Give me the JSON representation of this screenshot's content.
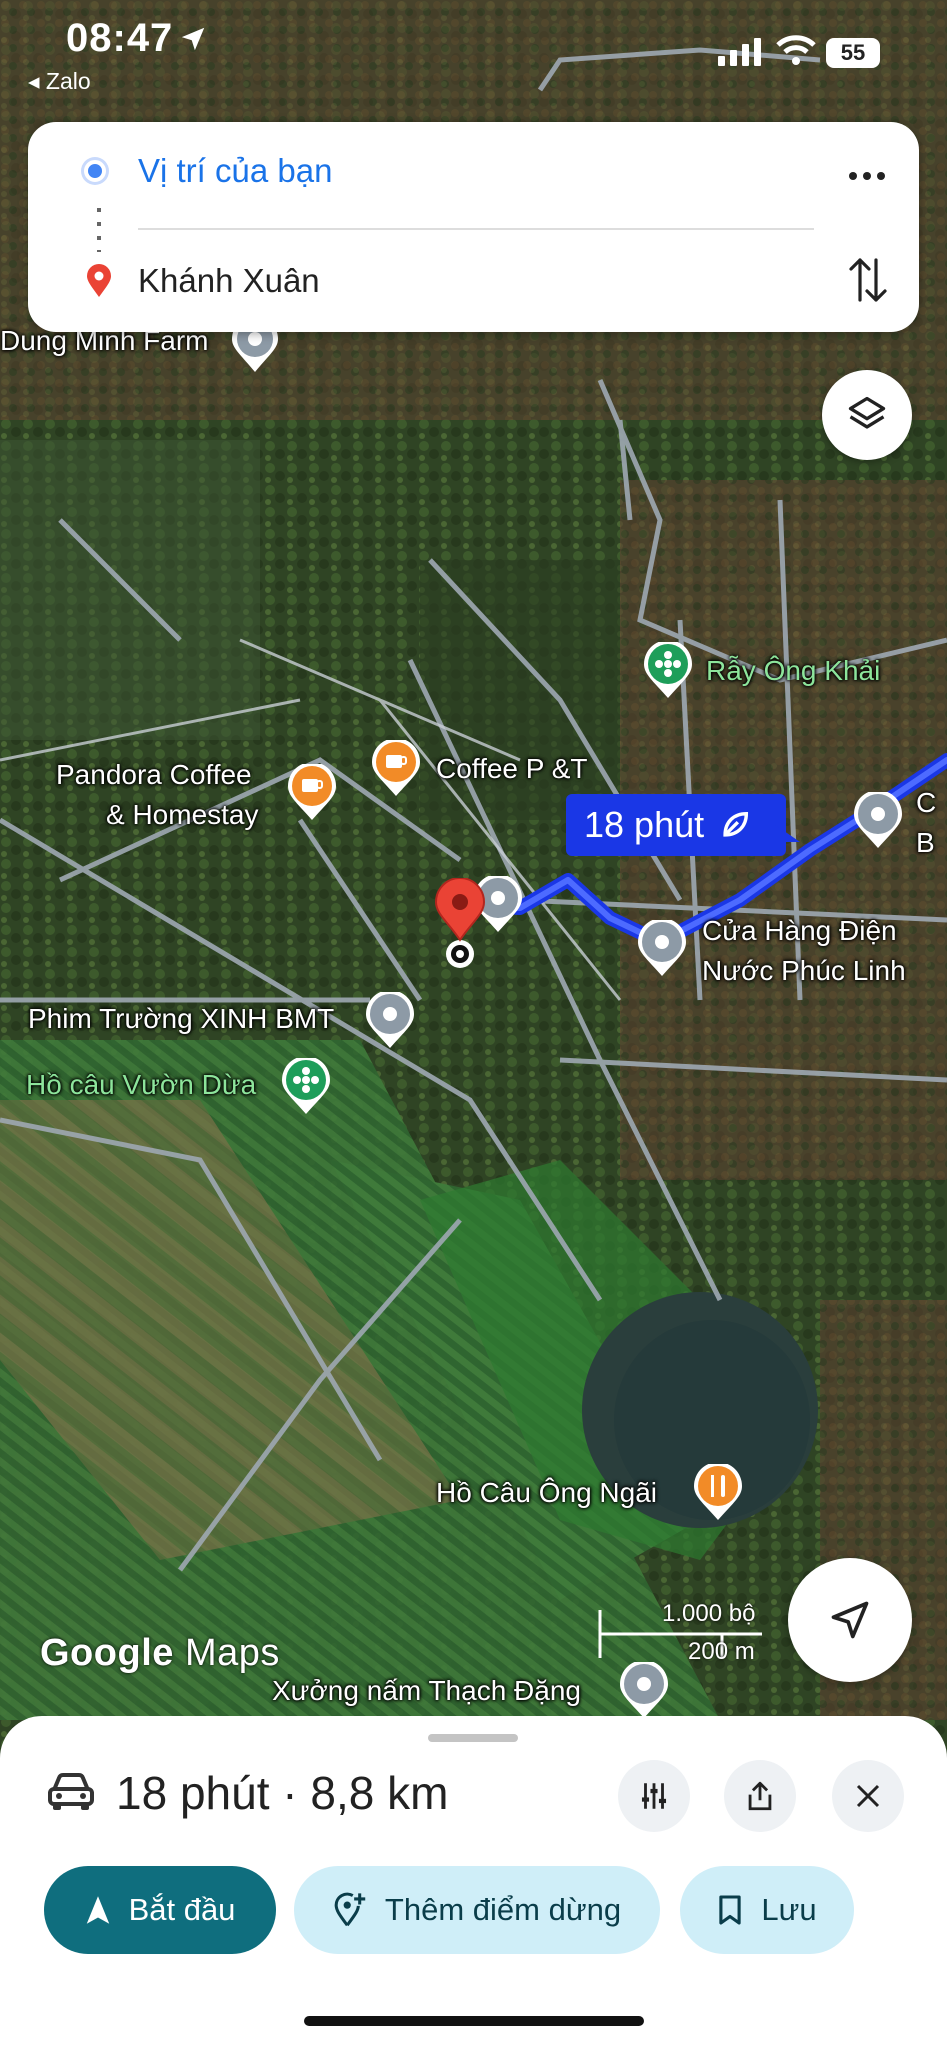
{
  "status_bar": {
    "time": "08:47",
    "back_app": "◂ Zalo",
    "battery": "55"
  },
  "directions": {
    "origin": "Vị trí của bạn",
    "destination": "Khánh Xuân"
  },
  "map": {
    "route_bubble": "18 phút",
    "pois": {
      "dung_minh_farm": "Dung Minh Farm",
      "ray_ong_khai": "Rẫy Ông Khải",
      "pandora_line1": "Pandora Coffee",
      "pandora_line2": "& Homestay",
      "coffee_pt": "Coffee P &T",
      "cua_hang_line1": "Cửa Hàng Điện",
      "cua_hang_line2": "Nước Phúc Linh",
      "phim_truong": "Phim Trường XINH BMT",
      "ho_cau_vuon_dua": "Hồ câu Vườn Dừa",
      "ho_cau_ong_ngai": "Hồ Câu Ông Ngãi",
      "xuong_nam": "Xưởng nấm Thạch Đặng",
      "partial_label_line1": "C",
      "partial_label_line2": "B"
    },
    "logo_google": "Google",
    "logo_maps": "Maps",
    "scale_feet": "1.000 bộ",
    "scale_meters": "200 m"
  },
  "bottom_sheet": {
    "summary": "18 phút · 8,8 km",
    "start_label": "Bắt đầu",
    "add_stop_label": "Thêm điểm dừng",
    "save_label": "Lưu"
  },
  "colors": {
    "route": "#1a37e6",
    "accent": "#0f6e7e",
    "link_blue": "#1a73e8",
    "pin_red": "#ea4335",
    "poi_orange": "#f28b27",
    "poi_green": "#1e9e5a"
  }
}
